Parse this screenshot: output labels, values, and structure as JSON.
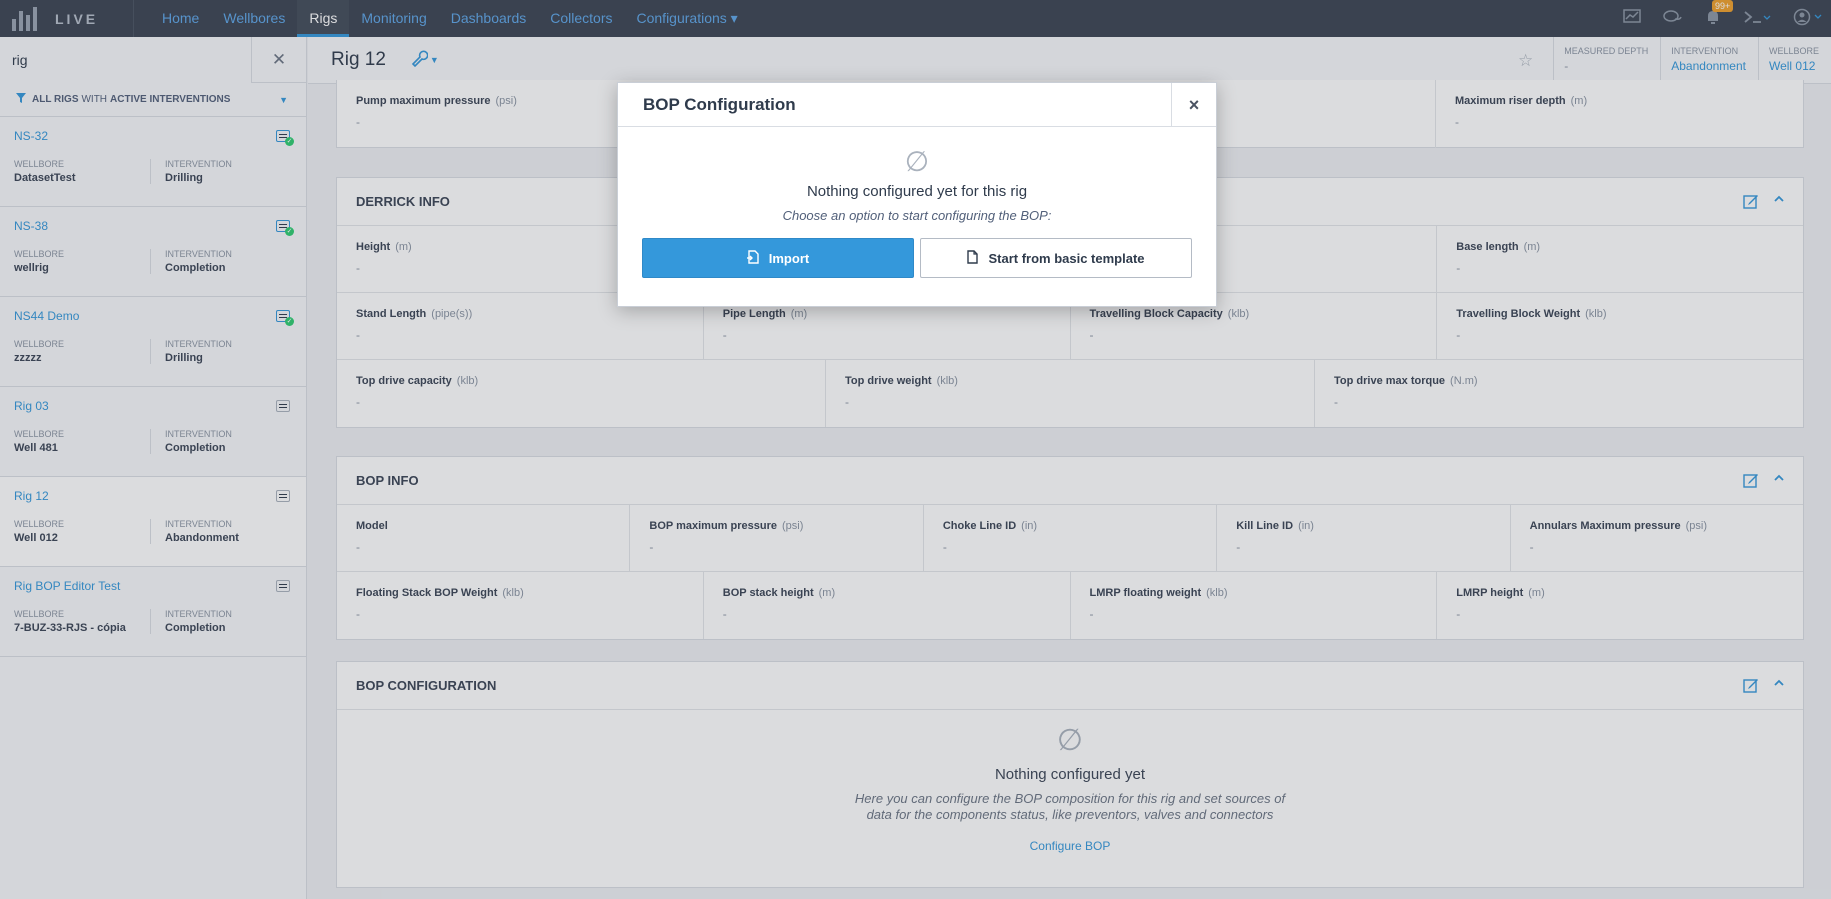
{
  "topnav": {
    "logo_text": "LIVE",
    "items": [
      {
        "label": "Home"
      },
      {
        "label": "Wellbores"
      },
      {
        "label": "Rigs"
      },
      {
        "label": "Monitoring"
      },
      {
        "label": "Dashboards"
      },
      {
        "label": "Collectors"
      },
      {
        "label": "Configurations ▾"
      }
    ],
    "active_item": "Rigs",
    "notification_badge": "99+"
  },
  "sidebar": {
    "search": {
      "value": "rig",
      "placeholder": ""
    },
    "filter": {
      "part1": "ALL RIGS",
      "part2": "WITH",
      "part3": "ACTIVE INTERVENTIONS"
    },
    "wellbore_label": "WELLBORE",
    "intervention_label": "INTERVENTION",
    "rigs": [
      {
        "name": "NS-32",
        "wellbore": "DatasetTest",
        "intervention": "Drilling",
        "active": true
      },
      {
        "name": "NS-38",
        "wellbore": "wellrig",
        "intervention": "Completion",
        "active": true
      },
      {
        "name": "NS44 Demo",
        "wellbore": "zzzzz",
        "intervention": "Drilling",
        "active": true
      },
      {
        "name": "Rig 03",
        "wellbore": "Well 481",
        "intervention": "Completion",
        "active": false
      },
      {
        "name": "Rig 12",
        "wellbore": "Well 012",
        "intervention": "Abandonment",
        "active": false
      },
      {
        "name": "Rig BOP Editor Test",
        "wellbore": "7-BUZ-33-RJS - cópia",
        "intervention": "Completion",
        "active": false
      }
    ]
  },
  "header": {
    "title": "Rig 12",
    "stats": [
      {
        "label": "MEASURED DEPTH",
        "value": "-"
      },
      {
        "label": "INTERVENTION",
        "value": "Abandonment"
      },
      {
        "label": "WELLBORE",
        "value": "Well 012"
      }
    ]
  },
  "panels": {
    "top_partial": {
      "fields": [
        {
          "label": "Pump maximum pressure",
          "unit": "(psi)",
          "value": "-"
        },
        {
          "label": "Maximum riser depth",
          "unit": "(m)",
          "value": "-"
        }
      ]
    },
    "derrick": {
      "title": "DERRICK INFO",
      "rows": [
        [
          {
            "label": "Height",
            "unit": "(m)",
            "value": "-"
          },
          {
            "label": "",
            "unit": "",
            "value": ""
          },
          {
            "label": "",
            "unit": "",
            "value": ""
          },
          {
            "label": "Base length",
            "unit": "(m)",
            "value": "-"
          }
        ],
        [
          {
            "label": "Stand Length",
            "unit": "(pipe(s))",
            "value": "-"
          },
          {
            "label": "Pipe Length",
            "unit": "(m)",
            "value": "-"
          },
          {
            "label": "Travelling Block Capacity",
            "unit": "(klb)",
            "value": "-"
          },
          {
            "label": "Travelling Block Weight",
            "unit": "(klb)",
            "value": "-"
          }
        ],
        [
          {
            "label": "Top drive capacity",
            "unit": "(klb)",
            "value": "-"
          },
          {
            "label": "Top drive weight",
            "unit": "(klb)",
            "value": "-"
          },
          {
            "label": "Top drive max torque",
            "unit": "(N.m)",
            "value": "-"
          }
        ]
      ]
    },
    "bop_info": {
      "title": "BOP INFO",
      "rows": [
        [
          {
            "label": "Model",
            "unit": "",
            "value": "-"
          },
          {
            "label": "BOP maximum pressure",
            "unit": "(psi)",
            "value": "-"
          },
          {
            "label": "Choke Line ID",
            "unit": "(in)",
            "value": "-"
          },
          {
            "label": "Kill Line ID",
            "unit": "(in)",
            "value": "-"
          },
          {
            "label": "Annulars Maximum pressure",
            "unit": "(psi)",
            "value": "-"
          }
        ],
        [
          {
            "label": "Floating Stack BOP Weight",
            "unit": "(klb)",
            "value": "-"
          },
          {
            "label": "BOP stack height",
            "unit": "(m)",
            "value": "-"
          },
          {
            "label": "LMRP floating weight",
            "unit": "(klb)",
            "value": "-"
          },
          {
            "label": "LMRP height",
            "unit": "(m)",
            "value": "-"
          }
        ]
      ]
    },
    "bop_config": {
      "title": "BOP CONFIGURATION",
      "empty_title": "Nothing configured yet",
      "empty_desc_1": "Here you can configure the BOP composition for this rig and set sources of",
      "empty_desc_2": "data for the components status, like preventors, valves and connectors",
      "link": "Configure BOP"
    }
  },
  "modal": {
    "title": "BOP Configuration",
    "close": "×",
    "empty_title": "Nothing configured yet for this rig",
    "empty_subtitle": "Choose an option to start configuring the BOP:",
    "import_label": "Import",
    "template_label": "Start from basic template"
  },
  "colors": {
    "accent": "#3498db",
    "nav_bg": "#3b4452",
    "success": "#2ecc71",
    "badge": "#f0a02b"
  },
  "icons": [
    "logo-icon",
    "chart-icon",
    "chat-icon",
    "bell-icon",
    "terminal-icon",
    "user-icon",
    "filter-icon",
    "wrench-icon",
    "star-icon",
    "edit-icon",
    "chevron-up-icon",
    "empty-set-icon",
    "import-icon",
    "document-icon",
    "close-icon"
  ]
}
